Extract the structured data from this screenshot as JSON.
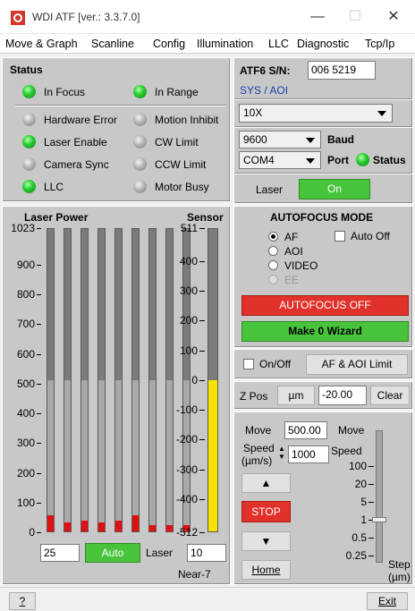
{
  "window": {
    "title": "WDI ATF [ver.: 3.3.7.0]"
  },
  "menu": [
    "Move & Graph",
    "Scanline",
    "Config",
    "Illumination",
    "LLC",
    "Diagnostic",
    "Tcp/Ip"
  ],
  "status": {
    "title": "Status",
    "top": [
      {
        "label": "In Focus",
        "state": "on"
      },
      {
        "label": "In Range",
        "state": "on"
      }
    ],
    "items": [
      {
        "label": "Hardware Error",
        "state": "off"
      },
      {
        "label": "Motion Inhibit",
        "state": "off"
      },
      {
        "label": "Laser Enable",
        "state": "on"
      },
      {
        "label": "CW Limit",
        "state": "off"
      },
      {
        "label": "Camera Sync",
        "state": "off"
      },
      {
        "label": "CCW Limit",
        "state": "off"
      },
      {
        "label": "LLC",
        "state": "on"
      },
      {
        "label": "Motor Busy",
        "state": "off"
      }
    ]
  },
  "atf": {
    "sn_label": "ATF6 S/N:",
    "sn_value": "006 5219",
    "sys_aoi": "SYS / AOI",
    "objective": "10X",
    "baud_value": "9600",
    "baud_label": "Baud",
    "port_value": "COM4",
    "port_label": "Port",
    "status_label": "Status",
    "laser_label": "Laser",
    "laser_state": "On"
  },
  "autofocus": {
    "title": "AUTOFOCUS MODE",
    "modes": [
      {
        "label": "AF",
        "selected": true
      },
      {
        "label": "AOI",
        "selected": false
      },
      {
        "label": "VIDEO",
        "selected": false
      },
      {
        "label": "EE",
        "selected": false,
        "disabled": true
      }
    ],
    "auto_off_label": "Auto Off",
    "off_button": "AUTOFOCUS OFF",
    "wizard_button": "Make 0 Wizard"
  },
  "onoff": {
    "label": "On/Off",
    "limit_button": "AF & AOI Limit"
  },
  "zpos": {
    "label": "Z Pos",
    "unit_button": "µm",
    "value": "-20.00",
    "clear_button": "Clear"
  },
  "move": {
    "move_label": "Move",
    "move_value": "500.00",
    "speed_label_1": "Speed",
    "speed_label_2": "(µm/s)",
    "speed_value": "1000",
    "stop_button": "STOP",
    "home_button": "Home",
    "move_scale_label": "Move",
    "speed_scale_label": "Speed",
    "step_scale": [
      "100",
      "20",
      "5",
      "1",
      "0.5",
      "0.25"
    ],
    "step_label_1": "Step",
    "step_label_2": "(µm)",
    "slider_level": "1"
  },
  "laser_power": {
    "title": "Laser Power",
    "scale": [
      "1023",
      "900",
      "800",
      "700",
      "600",
      "500",
      "400",
      "300",
      "200",
      "100",
      "0"
    ],
    "bar_values": [
      55,
      30,
      35,
      30,
      35,
      55,
      20,
      20,
      20
    ],
    "gray_level": 512,
    "power_value": "25",
    "auto_button": "Auto",
    "laser_label": "Laser",
    "laser_value": "10"
  },
  "sensor": {
    "title": "Sensor",
    "scale": [
      "511",
      "400",
      "300",
      "200",
      "100",
      "0",
      "-100",
      "-200",
      "-300",
      "-400",
      "-512"
    ],
    "value": 0,
    "status_text": "Near-7"
  },
  "footer": {
    "help": "?",
    "exit": "Exit"
  },
  "colors": {
    "led_on": "#27d233",
    "led_off": "#b5b5b5",
    "red_button": "#e0322a",
    "green_button": "#48c43c",
    "sensor_bar": "#f5e400",
    "laser_red": "#e01010"
  }
}
